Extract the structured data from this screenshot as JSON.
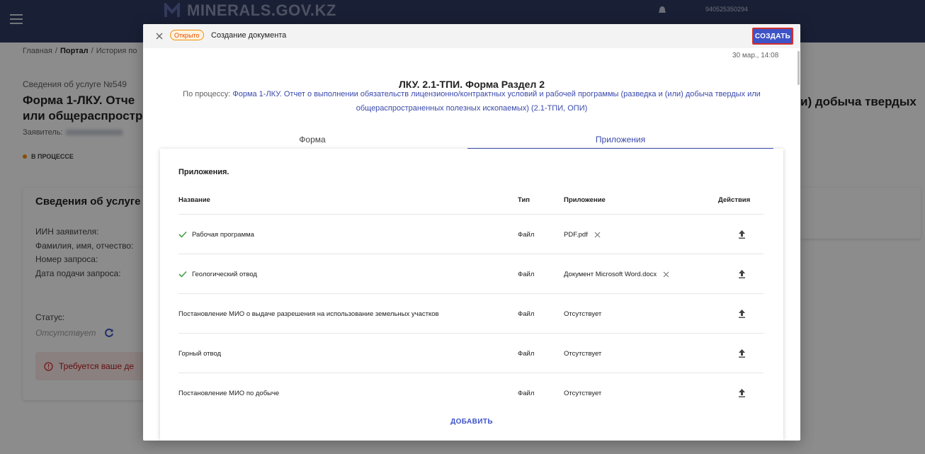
{
  "app": {
    "brand": "MINERALS.GOV.KZ",
    "user_id": "940525350294"
  },
  "breadcrumb": {
    "home": "Главная",
    "portal": "Портал",
    "history": "История по"
  },
  "service": {
    "number": "Сведения об услуге №549",
    "title": "Форма 1-ЛКУ. Отче или общераспростр",
    "title_right": "и) добыча твердых",
    "applicant_label": "Заявитель:",
    "status": "В ПРОЦЕССЕ",
    "status_color": "#f29100"
  },
  "info_card": {
    "heading": "Сведения об услуге",
    "fields": [
      "ИИН заявителя:",
      "Фамилия, имя, отчество:",
      "Номер запроса:",
      "Дата подачи запроса:"
    ],
    "status_label": "Статус:",
    "status_value": "Отсутствует",
    "alert": "Требуется ваше де"
  },
  "modal": {
    "badge": "Открыто",
    "title": "Создание документа",
    "create_label": "СОЗДАТЬ",
    "timestamp": "30 мар., 14:08",
    "form_title": "ЛКУ. 2.1-ТПИ. Форма Раздел 2",
    "process_prefix": "По процессу:",
    "process_link": "Форма 1-ЛКУ. Отчет о выполнении обязательств лицензионно/контрактных условий и рабочей программы (разведка и (или) добыча твердых или общераспространенных полезных ископаемых) (2.1-ТПИ, ОПИ)",
    "tabs": [
      {
        "label": "Форма",
        "active": false
      },
      {
        "label": "Приложения",
        "active": true
      }
    ],
    "accent_color": "#3d53c7"
  },
  "attachments": {
    "heading": "Приложения.",
    "columns": {
      "name": "Название",
      "type": "Тип",
      "app": "Приложение",
      "actions": "Действия"
    },
    "rows": [
      {
        "name": "Рабочая программа",
        "type": "Файл",
        "app": "PDF.pdf",
        "done": true
      },
      {
        "name": "Геологический отвод",
        "type": "Файл",
        "app": "Документ Microsoft Word.docx",
        "done": true
      },
      {
        "name": "Постановление МИО о выдаче разрешения на использование земельных участков",
        "type": "Файл",
        "app": "Отсутствует",
        "done": false
      },
      {
        "name": "Горный отвод",
        "type": "Файл",
        "app": "Отсутствует",
        "done": false
      },
      {
        "name": "Постановление МИО по добыче",
        "type": "Файл",
        "app": "Отсутствует",
        "done": false
      }
    ],
    "add_label": "ДОБАВИТЬ"
  }
}
